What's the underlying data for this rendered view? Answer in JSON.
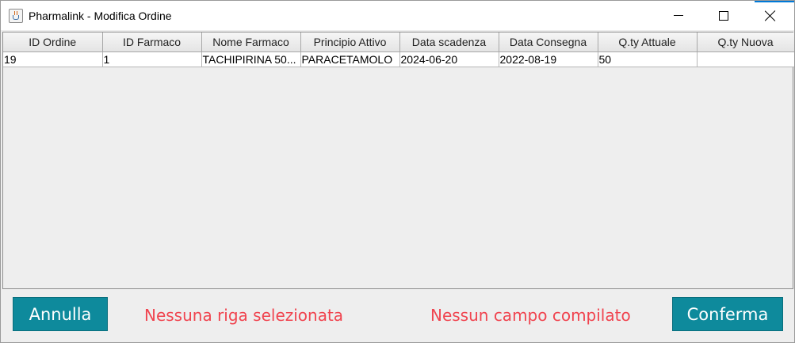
{
  "window": {
    "title": "Pharmalink - Modifica Ordine"
  },
  "table": {
    "columns": [
      "ID Ordine",
      "ID Farmaco",
      "Nome Farmaco",
      "Principio Attivo",
      "Data scadenza",
      "Data Consegna",
      "Q.ty Attuale",
      "Q.ty Nuova"
    ],
    "rows": [
      [
        "19",
        "1",
        "TACHIPIRINA 50...",
        "PARACETAMOLO",
        "2024-06-20",
        "2022-08-19",
        "50",
        ""
      ]
    ]
  },
  "footer": {
    "cancel_label": "Annulla",
    "confirm_label": "Conferma",
    "row_status": "Nessuna riga selezionata",
    "field_status": "Nessun campo compilato"
  },
  "colors": {
    "button_bg": "#0e8a9c",
    "status_text": "#f0444f",
    "window_accent": "#0078d7"
  }
}
